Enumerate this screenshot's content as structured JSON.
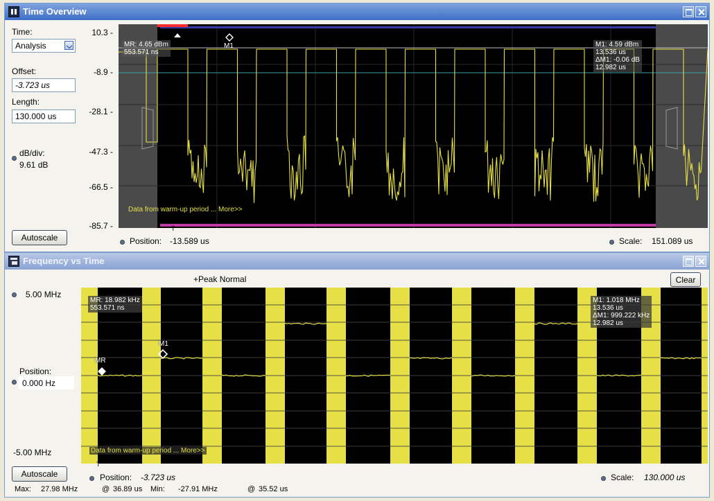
{
  "time_overview": {
    "title": "Time Overview",
    "time_label": "Time:",
    "time_mode": "Analysis",
    "offset_label": "Offset:",
    "offset_value": "-3.723 us",
    "length_label": "Length:",
    "length_value": "130.000 us",
    "dbdiv_label": "dB/div:",
    "dbdiv_value": "9.61 dB",
    "autoscale_label": "Autoscale",
    "y_ticks": [
      "10.3 -",
      "-8.9 -",
      "-28.1 -",
      "-47.3 -",
      "-66.5 -",
      "-85.7 -"
    ],
    "marker_mr_readout": "MR: 4.65 dBm\n553.571 ns",
    "marker_m1_readout": "M1: 4.59 dBm\n13.536 us\nΔM1: -0.06 dB\n12.982 us",
    "marker_m1_label": "M1",
    "trigger_label": "T",
    "warmup_text": "Data from warm-up period ... More>>",
    "position_label": "Position:",
    "position_value": "-13.589 us",
    "scale_label": "Scale:",
    "scale_value": "151.089 us"
  },
  "freq_vs_time": {
    "title": "Frequency vs Time",
    "detector_label": "+Peak Normal",
    "clear_label": "Clear",
    "top_value": "5.00 MHz",
    "position_label": "Position:",
    "position_value": "0.000 Hz",
    "bottom_value": "-5.00 MHz",
    "autoscale_label": "Autoscale",
    "marker_mr_readout": "MR: 18.982 kHz\n553.571 ns",
    "marker_m1_readout": "M1: 1.018 MHz\n13.536 us\nΔM1: 999.222 kHz\n12.982 us",
    "marker_mr_label": "MR",
    "marker_m1_label": "M1",
    "trigger_label": "T",
    "warmup_text": "Data from warm-up period ... More>>",
    "bottom_position_label": "Position:",
    "bottom_position_value": "-3.723 us",
    "scale_label": "Scale:",
    "scale_value": "130.000 us"
  },
  "status_bar": {
    "max_label": "Max:",
    "max_value": "27.98 MHz",
    "max_at_label": "@",
    "max_at_value": "36.89 us",
    "min_label": "Min:",
    "min_value": "-27.91 MHz",
    "min_at_label": "@",
    "min_at_value": "35.52 us"
  },
  "colors": {
    "trace": "#e6e046",
    "plot_bg": "#000000",
    "gray_region": "#505050",
    "mr_marker_bar": "#ff2a2a",
    "top_bar": "#3a3aa6",
    "bottom_bar": "#c03aa6"
  }
}
